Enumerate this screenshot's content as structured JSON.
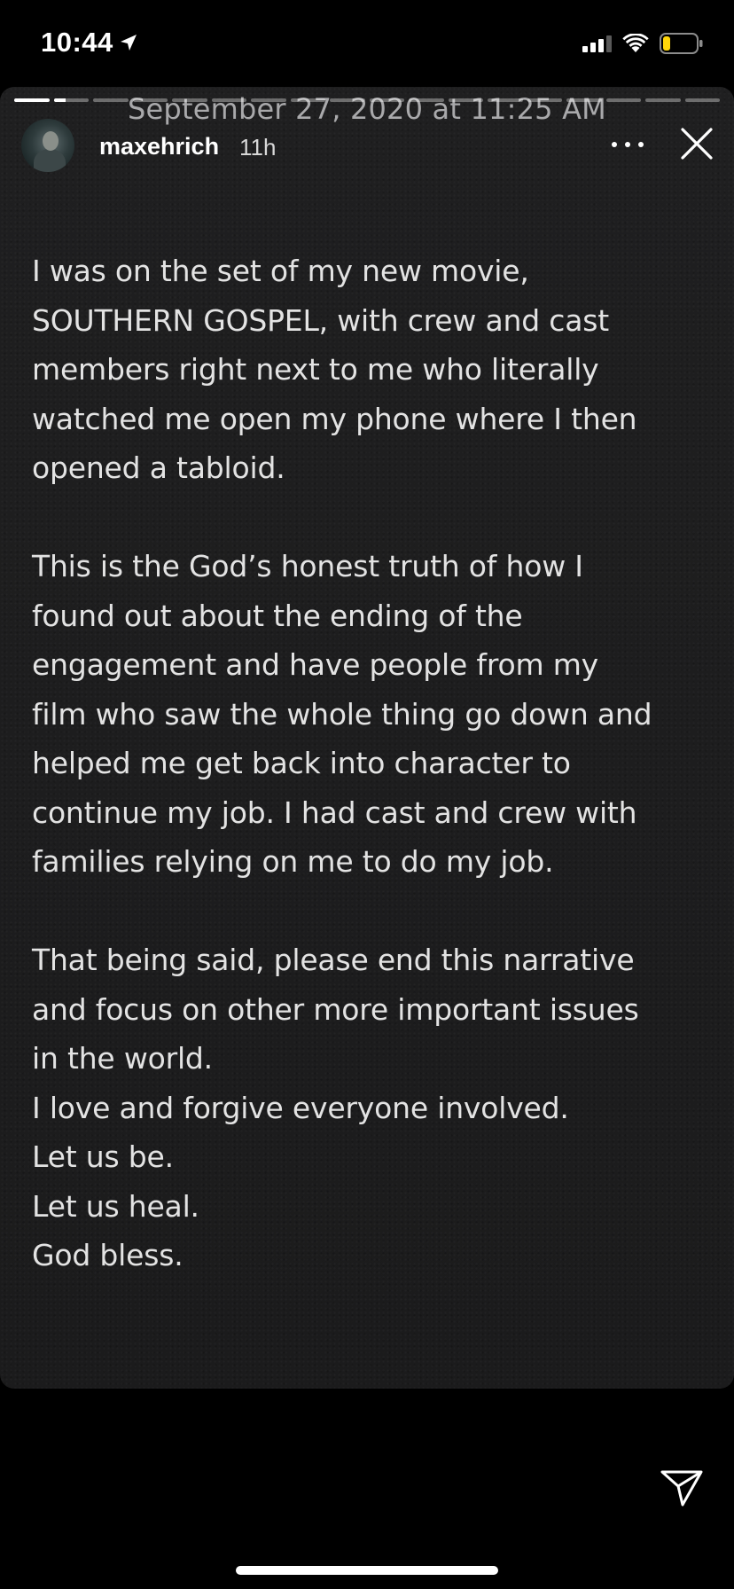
{
  "status_bar": {
    "time": "10:44",
    "location_icon": "location-arrow-icon",
    "signal_icon": "cellular-signal-icon",
    "wifi_icon": "wifi-icon",
    "battery_icon": "battery-low-icon",
    "battery_color": "#ffd60a"
  },
  "story": {
    "date_overlay": "September 27, 2020 at 11:25 AM",
    "username": "maxehrich",
    "time_ago": "11h",
    "progress": [
      1,
      0.35,
      0,
      0,
      0,
      0,
      0,
      0,
      0,
      0,
      0,
      0,
      0,
      0,
      0,
      0,
      0,
      0
    ],
    "paragraphs": [
      "I was on the set of my new movie,\nSOUTHERN GOSPEL, with crew and cast\nmembers right next to me who literally\nwatched me open my phone where I then\nopened a tabloid.",
      "This is the God’s honest truth of how I\nfound out about the ending of the\nengagement and have people from my\nfilm who saw the whole thing go down and\nhelped me get back into character to\ncontinue my job. I had cast and crew with\nfamilies relying on me to do my job.",
      "That being said, please end this narrative\nand focus on other more important issues\nin the world.\nI love and forgive everyone involved.\nLet us be.\nLet us heal.\nGod bless."
    ]
  },
  "controls": {
    "more_icon": "more-dots-icon",
    "close_icon": "close-icon",
    "send_icon": "send-paper-plane-icon"
  }
}
